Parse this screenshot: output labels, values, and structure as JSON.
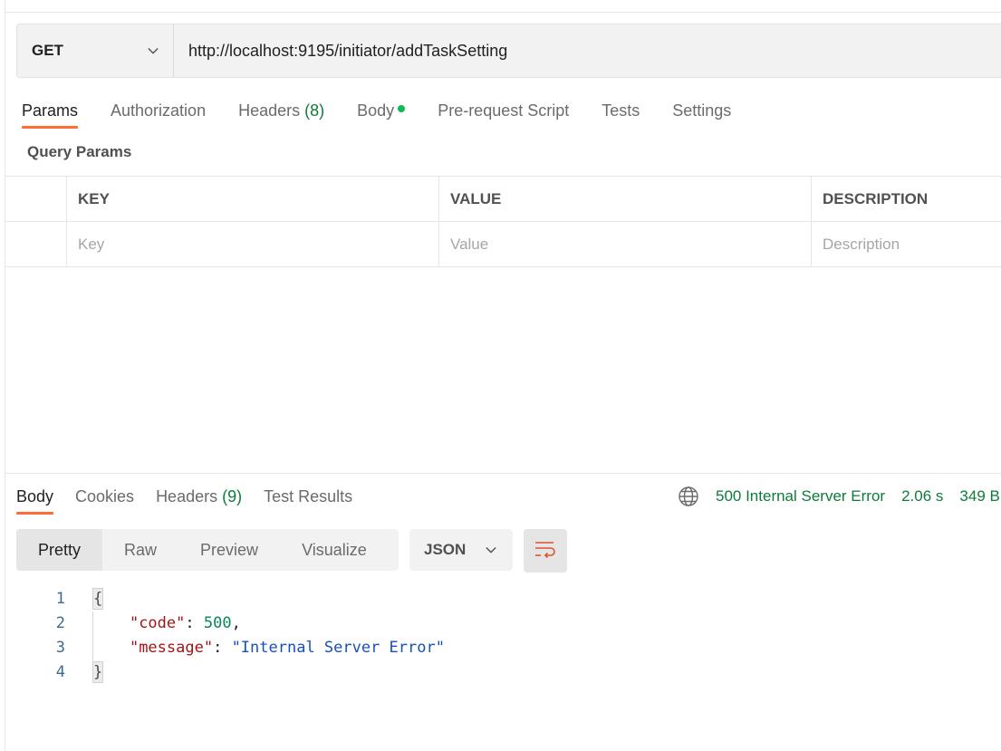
{
  "request": {
    "method": "GET",
    "url": "http://localhost:9195/initiator/addTaskSetting"
  },
  "request_tabs": [
    {
      "label": "Params",
      "active": true
    },
    {
      "label": "Authorization"
    },
    {
      "label": "Headers",
      "count": "(8)"
    },
    {
      "label": "Body",
      "has_indicator": true
    },
    {
      "label": "Pre-request Script"
    },
    {
      "label": "Tests"
    },
    {
      "label": "Settings"
    }
  ],
  "query_params": {
    "title": "Query Params",
    "columns": [
      "KEY",
      "VALUE",
      "DESCRIPTION"
    ],
    "placeholders": [
      "Key",
      "Value",
      "Description"
    ]
  },
  "response_tabs": [
    {
      "label": "Body",
      "active": true
    },
    {
      "label": "Cookies"
    },
    {
      "label": "Headers",
      "count": "(9)"
    },
    {
      "label": "Test Results"
    }
  ],
  "response_status": {
    "status": "500 Internal Server Error",
    "time": "2.06 s",
    "size": "349 B",
    "icon": "globe-icon"
  },
  "format_tabs": [
    "Pretty",
    "Raw",
    "Preview",
    "Visualize"
  ],
  "format_active": "Pretty",
  "language": "JSON",
  "wrap_icon": "text-wrap-icon",
  "response_body": {
    "line_numbers": [
      "1",
      "2",
      "3",
      "4"
    ],
    "open_brace": "{",
    "close_brace": "}",
    "code_key": "\"code\"",
    "code_value": "500",
    "message_key": "\"message\"",
    "message_value": "\"Internal Server Error\""
  },
  "colors": {
    "accent": "#ff6c37",
    "status_green": "#0f7b3a",
    "indicator_green": "#0cbb52"
  }
}
